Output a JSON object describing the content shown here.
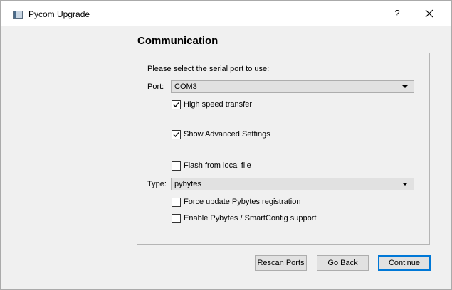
{
  "window": {
    "title": "Pycom Upgrade",
    "help_label": "?"
  },
  "page": {
    "heading": "Communication",
    "prompt": "Please select the serial port to use:",
    "port": {
      "label": "Port:",
      "value": "COM3"
    },
    "type": {
      "label": "Type:",
      "value": "pybytes"
    },
    "checks": [
      {
        "label": "High speed transfer",
        "checked": true
      },
      {
        "label": "Show Advanced Settings",
        "checked": true
      },
      {
        "label": "Flash from local file",
        "checked": false
      },
      {
        "label": "Force update Pybytes registration",
        "checked": false
      },
      {
        "label": "Enable Pybytes / SmartConfig support",
        "checked": false
      }
    ]
  },
  "buttons": {
    "rescan": "Rescan Ports",
    "back": "Go Back",
    "continue": "Continue"
  },
  "colors": {
    "accent": "#0078d7",
    "window_bg": "#f0f0f0",
    "titlebar_bg": "#ffffff"
  },
  "icons": {
    "app": "app-window-icon",
    "close": "close-icon",
    "dropdown": "chevron-down-icon",
    "check": "checkmark-icon"
  }
}
